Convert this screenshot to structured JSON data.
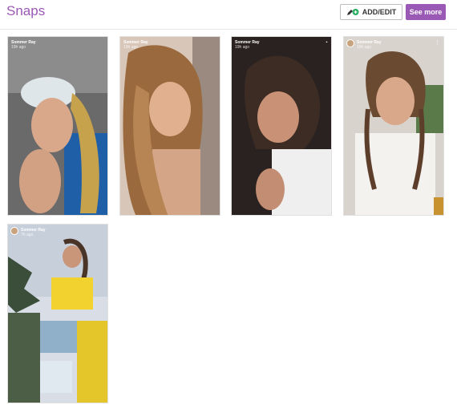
{
  "header": {
    "title": "Snaps",
    "add_edit_label": "ADD/EDIT",
    "see_more_label": "See more"
  },
  "snaps": [
    {
      "name": "Sommer Ray",
      "time": "19h ago",
      "corner_icon": ""
    },
    {
      "name": "Sommer Ray",
      "time": "19h ago",
      "corner_icon": ""
    },
    {
      "name": "Sommer Ray",
      "time": "19h ago",
      "corner_icon": "loading-icon"
    },
    {
      "name": "Sommer Ray",
      "time": "19h ago",
      "corner_icon": "more-vertical-icon"
    },
    {
      "name": "Sommer Ray",
      "time": "7h ago",
      "corner_icon": ""
    }
  ],
  "colors": {
    "accent": "#9b59b6",
    "add_edit_icon_green": "#27ae60"
  }
}
